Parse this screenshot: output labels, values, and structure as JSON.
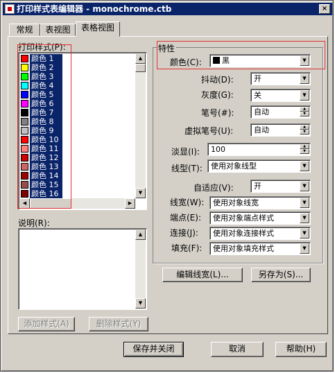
{
  "window": {
    "title": "打印样式表编辑器 - monochrome.ctb",
    "close_glyph": "×"
  },
  "tabs": [
    {
      "label": "常规",
      "active": false
    },
    {
      "label": "表视图",
      "active": false
    },
    {
      "label": "表格视图",
      "active": true
    }
  ],
  "styles_list": {
    "label": "打印样式(P):",
    "items": [
      {
        "label": "颜色 1",
        "color": "#ff0000"
      },
      {
        "label": "颜色 2",
        "color": "#ffff00"
      },
      {
        "label": "颜色 3",
        "color": "#00ff00"
      },
      {
        "label": "颜色 4",
        "color": "#00ffff"
      },
      {
        "label": "颜色 5",
        "color": "#0000ff"
      },
      {
        "label": "颜色 6",
        "color": "#ff00ff"
      },
      {
        "label": "颜色 7",
        "color": "#000000"
      },
      {
        "label": "颜色 8",
        "color": "#808080"
      },
      {
        "label": "颜色 9",
        "color": "#c0c0c0"
      },
      {
        "label": "颜色 10",
        "color": "#ff0000"
      },
      {
        "label": "颜色 11",
        "color": "#ff7f7f"
      },
      {
        "label": "颜色 12",
        "color": "#cc0000"
      },
      {
        "label": "颜色 13",
        "color": "#cc6666"
      },
      {
        "label": "颜色 14",
        "color": "#990000"
      },
      {
        "label": "颜色 15",
        "color": "#994c4c"
      },
      {
        "label": "颜色 16",
        "color": "#7f0000"
      }
    ]
  },
  "description": {
    "label": "说明(R):",
    "value": ""
  },
  "buttons": {
    "add_style": "添加样式(A)",
    "delete_style": "删除样式(Y)",
    "edit_lineweights": "编辑线宽(L)...",
    "save_as": "另存为(S)...",
    "save_close": "保存并关闭",
    "cancel": "取消",
    "help": "帮助(H)"
  },
  "properties": {
    "group_title": "特性",
    "color": {
      "label": "颜色(C):",
      "value": "黑",
      "swatch": "#000000"
    },
    "dither": {
      "label": "抖动(D):",
      "value": "开"
    },
    "grayscale": {
      "label": "灰度(G):",
      "value": "关"
    },
    "pen_number": {
      "label": "笔号(#):",
      "value": "自动"
    },
    "virtual_pen": {
      "label": "虚拟笔号(U):",
      "value": "自动"
    },
    "screening": {
      "label": "淡显(I):",
      "value": "100"
    },
    "linetype": {
      "label": "线型(T):",
      "value": "使用对象线型"
    },
    "adaptive": {
      "label": "自适应(V):",
      "value": "开"
    },
    "lineweight": {
      "label": "线宽(W):",
      "value": "使用对象线宽"
    },
    "line_end": {
      "label": "端点(E):",
      "value": "使用对象端点样式"
    },
    "line_join": {
      "label": "连接(J):",
      "value": "使用对象连接样式"
    },
    "fill": {
      "label": "填充(F):",
      "value": "使用对象填充样式"
    }
  }
}
